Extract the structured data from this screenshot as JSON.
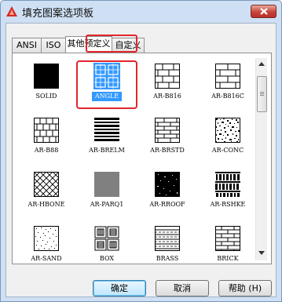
{
  "window": {
    "title": "填充图案选项板"
  },
  "tabs": [
    {
      "label": "ANSI",
      "active": false
    },
    {
      "label": "ISO",
      "active": false
    },
    {
      "label": "其他预定义",
      "active": true
    },
    {
      "label": "自定义",
      "active": false
    }
  ],
  "patterns": [
    {
      "name": "SOLID",
      "selected": false
    },
    {
      "name": "ANGLE",
      "selected": true
    },
    {
      "name": "AR-B816",
      "selected": false
    },
    {
      "name": "AR-B816C",
      "selected": false
    },
    {
      "name": "AR-B88",
      "selected": false
    },
    {
      "name": "AR-BRELM",
      "selected": false
    },
    {
      "name": "AR-BRSTD",
      "selected": false
    },
    {
      "name": "AR-CONC",
      "selected": false
    },
    {
      "name": "AR-HBONE",
      "selected": false
    },
    {
      "name": "AR-PARQ1",
      "selected": false
    },
    {
      "name": "AR-RROOF",
      "selected": false
    },
    {
      "name": "AR-RSHKE",
      "selected": false
    },
    {
      "name": "AR-SAND",
      "selected": false
    },
    {
      "name": "BOX",
      "selected": false
    },
    {
      "name": "BRASS",
      "selected": false
    },
    {
      "name": "BRICK",
      "selected": false
    }
  ],
  "buttons": {
    "ok": "确定",
    "cancel": "取消",
    "help": "帮助 (H)"
  },
  "colors": {
    "highlight": "#e0262c",
    "selection": "#3399ff",
    "titlebar": "#cfe0f4"
  }
}
